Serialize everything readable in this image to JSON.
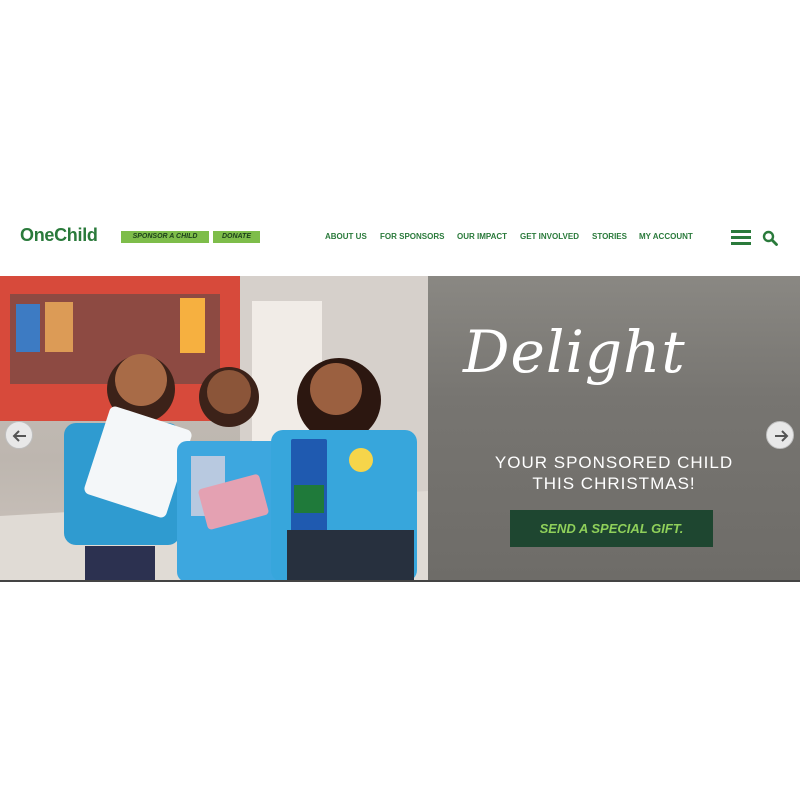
{
  "header": {
    "logo": "OneChild",
    "sponsor_label": "SPONSOR A CHILD",
    "donate_label": "DONATE",
    "nav": [
      "ABOUT US",
      "FOR SPONSORS",
      "OUR IMPACT",
      "GET INVOLVED",
      "STORIES",
      "MY ACCOUNT"
    ],
    "icons": [
      "menu-icon",
      "search-icon"
    ]
  },
  "hero": {
    "headline": "Delight",
    "subline_1": "YOUR SPONSORED CHILD",
    "subline_2": "THIS CHRISTMAS!",
    "cta": "SEND A SPECIAL GIFT.",
    "prev_icon": "arrow-left-icon",
    "next_icon": "arrow-right-icon"
  },
  "colors": {
    "brand_green": "#2a7a3b",
    "button_light_green": "#7ebd4a",
    "cta_dark_green": "#1e4630"
  }
}
